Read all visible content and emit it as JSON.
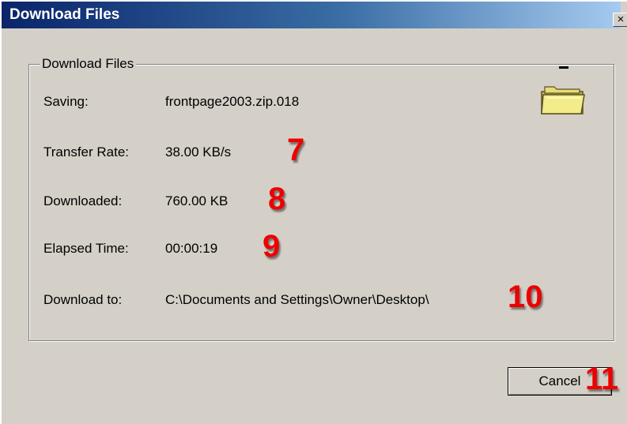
{
  "window": {
    "title": "Download Files",
    "close_glyph": "×"
  },
  "group": {
    "legend": "Download Files",
    "rows": [
      {
        "label": "Saving:",
        "value": "frontpage2003.zip.018"
      },
      {
        "label": "Transfer Rate:",
        "value": "38.00 KB/s"
      },
      {
        "label": "Downloaded:",
        "value": "760.00 KB"
      },
      {
        "label": "Elapsed Time:",
        "value": "00:00:19"
      },
      {
        "label": "Download to:",
        "value": "C:\\Documents and Settings\\Owner\\Desktop\\"
      }
    ],
    "icon": "folder-icon"
  },
  "annotations": {
    "transfer_rate": "7",
    "downloaded": "8",
    "elapsed_time": "9",
    "download_to": "10",
    "cancel": "11"
  },
  "buttons": {
    "cancel_label": "Cancel"
  },
  "colors": {
    "titlebar_start": "#0a246a",
    "titlebar_end": "#a6caf0",
    "dialog_face": "#d4d0c8",
    "annotation": "#ee0000",
    "folder": "#f4ec8a"
  }
}
